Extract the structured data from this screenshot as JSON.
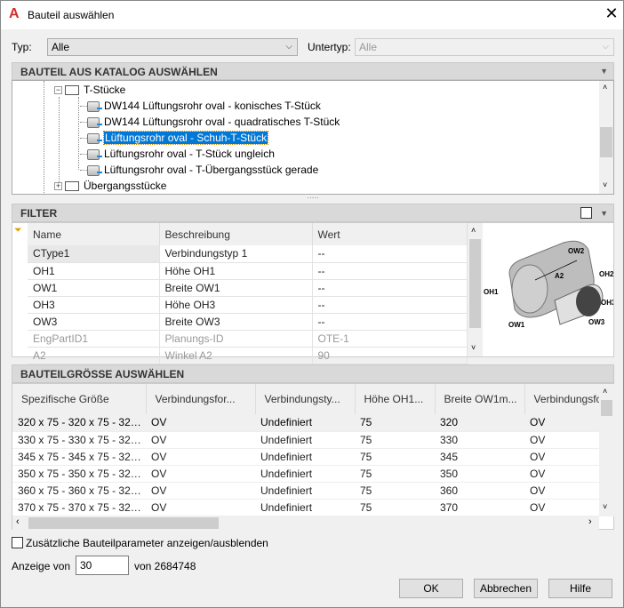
{
  "window": {
    "title": "Bauteil auswählen",
    "close_icon": "close-icon",
    "logo": "A"
  },
  "typ": {
    "label": "Typ:",
    "value": "Alle"
  },
  "untertyp": {
    "label": "Untertyp:",
    "value": "Alle"
  },
  "catalog": {
    "header": "BAUTEIL AUS KATALOG AUSWÄHLEN",
    "folder": "T-Stücke",
    "items": [
      "DW144 Lüftungsrohr oval - konisches T-Stück",
      "DW144 Lüftungsrohr oval - quadratisches T-Stück",
      "Lüftungsrohr oval - Schuh-T-Stück",
      "Lüftungsrohr oval - T-Stück ungleich",
      "Lüftungsrohr oval - T-Übergangsstück gerade"
    ],
    "selected_index": 2,
    "next_folder": "Übergangsstücke"
  },
  "filter": {
    "header": "FILTER",
    "columns": [
      "Name",
      "Beschreibung",
      "Wert"
    ],
    "rows": [
      [
        "CType1",
        "Verbindungstyp 1",
        "--"
      ],
      [
        "OH1",
        "Höhe OH1",
        "--"
      ],
      [
        "OW1",
        "Breite OW1",
        "--"
      ],
      [
        "OH3",
        "Höhe OH3",
        "--"
      ],
      [
        "OW3",
        "Breite OW3",
        "--"
      ],
      [
        "EngPartID1",
        "Planungs-ID",
        "OTE-1"
      ],
      [
        "A2",
        "Winkel A2",
        "90"
      ]
    ],
    "preview_labels": [
      "OW2",
      "OH2",
      "A2",
      "OH1",
      "OH3",
      "OW1",
      "OW3"
    ]
  },
  "sizes": {
    "header": "BAUTEILGRÖSSE AUSWÄHLEN",
    "columns": [
      "Spezifische Größe",
      "Verbindungsfor...",
      "Verbindungsty...",
      "Höhe OH1...",
      "Breite OW1m...",
      "Verbindungsfo"
    ],
    "rows": [
      [
        "320 x 75 - 320 x 75 - 320 x...",
        "OV",
        "Undefiniert",
        "75",
        "320",
        "OV"
      ],
      [
        "330 x 75 - 330 x 75 - 320 x...",
        "OV",
        "Undefiniert",
        "75",
        "330",
        "OV"
      ],
      [
        "345 x 75 - 345 x 75 - 320 x...",
        "OV",
        "Undefiniert",
        "75",
        "345",
        "OV"
      ],
      [
        "350 x 75 - 350 x 75 - 320 x...",
        "OV",
        "Undefiniert",
        "75",
        "350",
        "OV"
      ],
      [
        "360 x 75 - 360 x 75 - 320 x...",
        "OV",
        "Undefiniert",
        "75",
        "360",
        "OV"
      ],
      [
        "370 x 75 - 370 x 75 - 320 x...",
        "OV",
        "Undefiniert",
        "75",
        "370",
        "OV"
      ]
    ]
  },
  "options": {
    "toggle_label": "Zusätzliche Bauteilparameter anzeigen/ausblenden",
    "checked": false
  },
  "display": {
    "label": "Anzeige von",
    "value": "30",
    "total": "von 2684748"
  },
  "buttons": {
    "ok": "OK",
    "cancel": "Abbrechen",
    "help": "Hilfe"
  }
}
